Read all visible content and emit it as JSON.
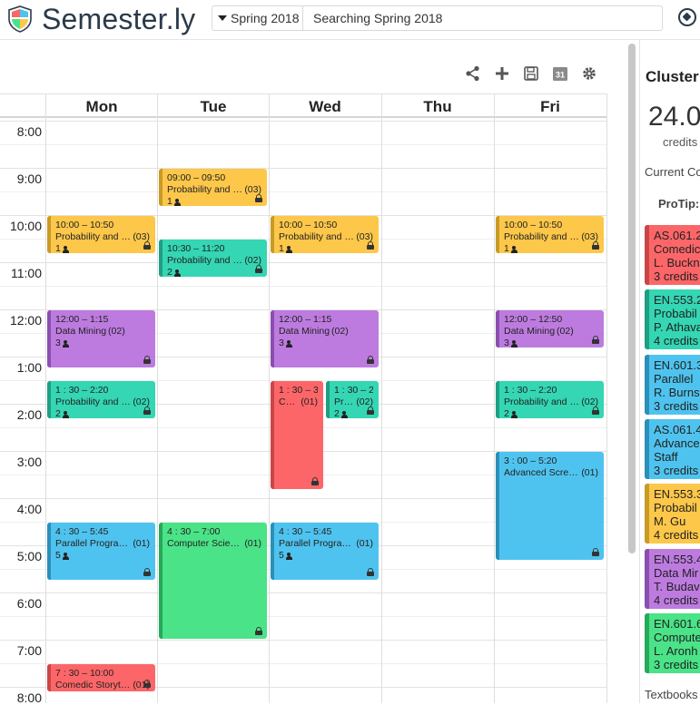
{
  "header": {
    "logo_text": "Semester.ly",
    "semester": "Spring 2018",
    "search_placeholder": "Searching Spring 2018"
  },
  "colors": {
    "yellow": "#fdc74a",
    "teal": "#34d6b3",
    "purple": "#bd7bdf",
    "red": "#fd6668",
    "blue": "#4fc3ef",
    "green": "#4ae388"
  },
  "calendar": {
    "days": [
      "Mon",
      "Tue",
      "Wed",
      "Thu",
      "Fri"
    ],
    "times": [
      "8:00",
      "9:00",
      "10:00",
      "11:00",
      "12:00",
      "1:00",
      "2:00",
      "3:00",
      "4:00",
      "5:00",
      "6:00",
      "7:00",
      "8:00"
    ],
    "slots": [
      {
        "day": 1,
        "time": "09:00 – 09:50",
        "name": "Probability and S...",
        "section": "(03)",
        "enrolled": "1",
        "color": "yellow"
      },
      {
        "day": 0,
        "time": "10:00 – 10:50",
        "name": "Probability and S...",
        "section": "(03)",
        "enrolled": "1",
        "color": "yellow"
      },
      {
        "day": 2,
        "time": "10:00 – 10:50",
        "name": "Probability and St...",
        "section": "(03)",
        "enrolled": "1",
        "color": "yellow"
      },
      {
        "day": 4,
        "time": "10:00 – 10:50",
        "name": "Probability and St...",
        "section": "(03)",
        "enrolled": "1",
        "color": "yellow"
      },
      {
        "day": 1,
        "time": "10:30 – 11:20",
        "name": "Probability and S...",
        "section": "(02)",
        "enrolled": "2",
        "color": "teal"
      },
      {
        "day": 0,
        "time": "12:00 – 1:15",
        "name": "Data Mining",
        "section": "(02)",
        "enrolled": "3",
        "color": "purple"
      },
      {
        "day": 2,
        "time": "12:00 – 1:15",
        "name": "Data Mining",
        "section": "(02)",
        "enrolled": "3",
        "color": "purple"
      },
      {
        "day": 4,
        "time": "12:00 – 12:50",
        "name": "Data Mining",
        "section": "(02)",
        "enrolled": "3",
        "color": "purple"
      },
      {
        "day": 0,
        "time": "1 : 30 – 2:20",
        "name": "Probability and S...",
        "section": "(02)",
        "enrolled": "2",
        "color": "teal"
      },
      {
        "day": 2,
        "time": "1 : 30 – 3:5",
        "name": "Com...",
        "section": "(01)",
        "enrolled": "",
        "color": "red"
      },
      {
        "day": 2,
        "time": "1 : 30 – 2:2",
        "name": "Prob...",
        "section": "(02)",
        "enrolled": "2",
        "color": "teal"
      },
      {
        "day": 4,
        "time": "1 : 30 – 2:20",
        "name": "Probability and St...",
        "section": "(02)",
        "enrolled": "2",
        "color": "teal"
      },
      {
        "day": 4,
        "time": "3 : 00 – 5:20",
        "name": "Advanced Screen...",
        "section": "(01)",
        "enrolled": "",
        "color": "blue"
      },
      {
        "day": 0,
        "time": "4 : 30 – 5:45",
        "name": "Parallel Program...",
        "section": "(01)",
        "enrolled": "5",
        "color": "blue"
      },
      {
        "day": 1,
        "time": "4 : 30 – 7:00",
        "name": "Computer Scienc...",
        "section": "(01)",
        "enrolled": "",
        "color": "green"
      },
      {
        "day": 2,
        "time": "4 : 30 – 5:45",
        "name": "Parallel Program...",
        "section": "(01)",
        "enrolled": "5",
        "color": "blue"
      },
      {
        "day": 0,
        "time": "7 : 30 – 10:00",
        "name": "Comedic Storytel...",
        "section": "(01)",
        "enrolled": "",
        "color": "red"
      }
    ]
  },
  "sidebar": {
    "title": "Cluster",
    "credits": "24.0",
    "credits_label": "credits",
    "current_courses_label": "Current Co",
    "protip": "ProTip:",
    "courses": [
      {
        "code": "AS.061.2",
        "name": "Comedic",
        "instructor": "L. Buckn",
        "credits": "3 credits",
        "color": "red"
      },
      {
        "code": "EN.553.2",
        "name": "Probabil",
        "instructor": "P. Athava",
        "credits": "4 credits",
        "color": "teal"
      },
      {
        "code": "EN.601.3",
        "name": "Parallel",
        "instructor": "R. Burns",
        "credits": "3 credits",
        "color": "blue"
      },
      {
        "code": "AS.061.4",
        "name": "Advance",
        "instructor": "Staff",
        "credits": "3 credits",
        "color": "blue"
      },
      {
        "code": "EN.553.3",
        "name": "Probabil",
        "instructor": "M. Gu",
        "credits": "4 credits",
        "color": "yellow"
      },
      {
        "code": "EN.553.4",
        "name": "Data Mir",
        "instructor": "T. Budav",
        "credits": "4 credits",
        "color": "purple"
      },
      {
        "code": "EN.601.6",
        "name": "Compute",
        "instructor": "L. Aronh",
        "credits": "3 credits",
        "color": "green"
      }
    ],
    "textbooks_label": "Textbooks"
  }
}
